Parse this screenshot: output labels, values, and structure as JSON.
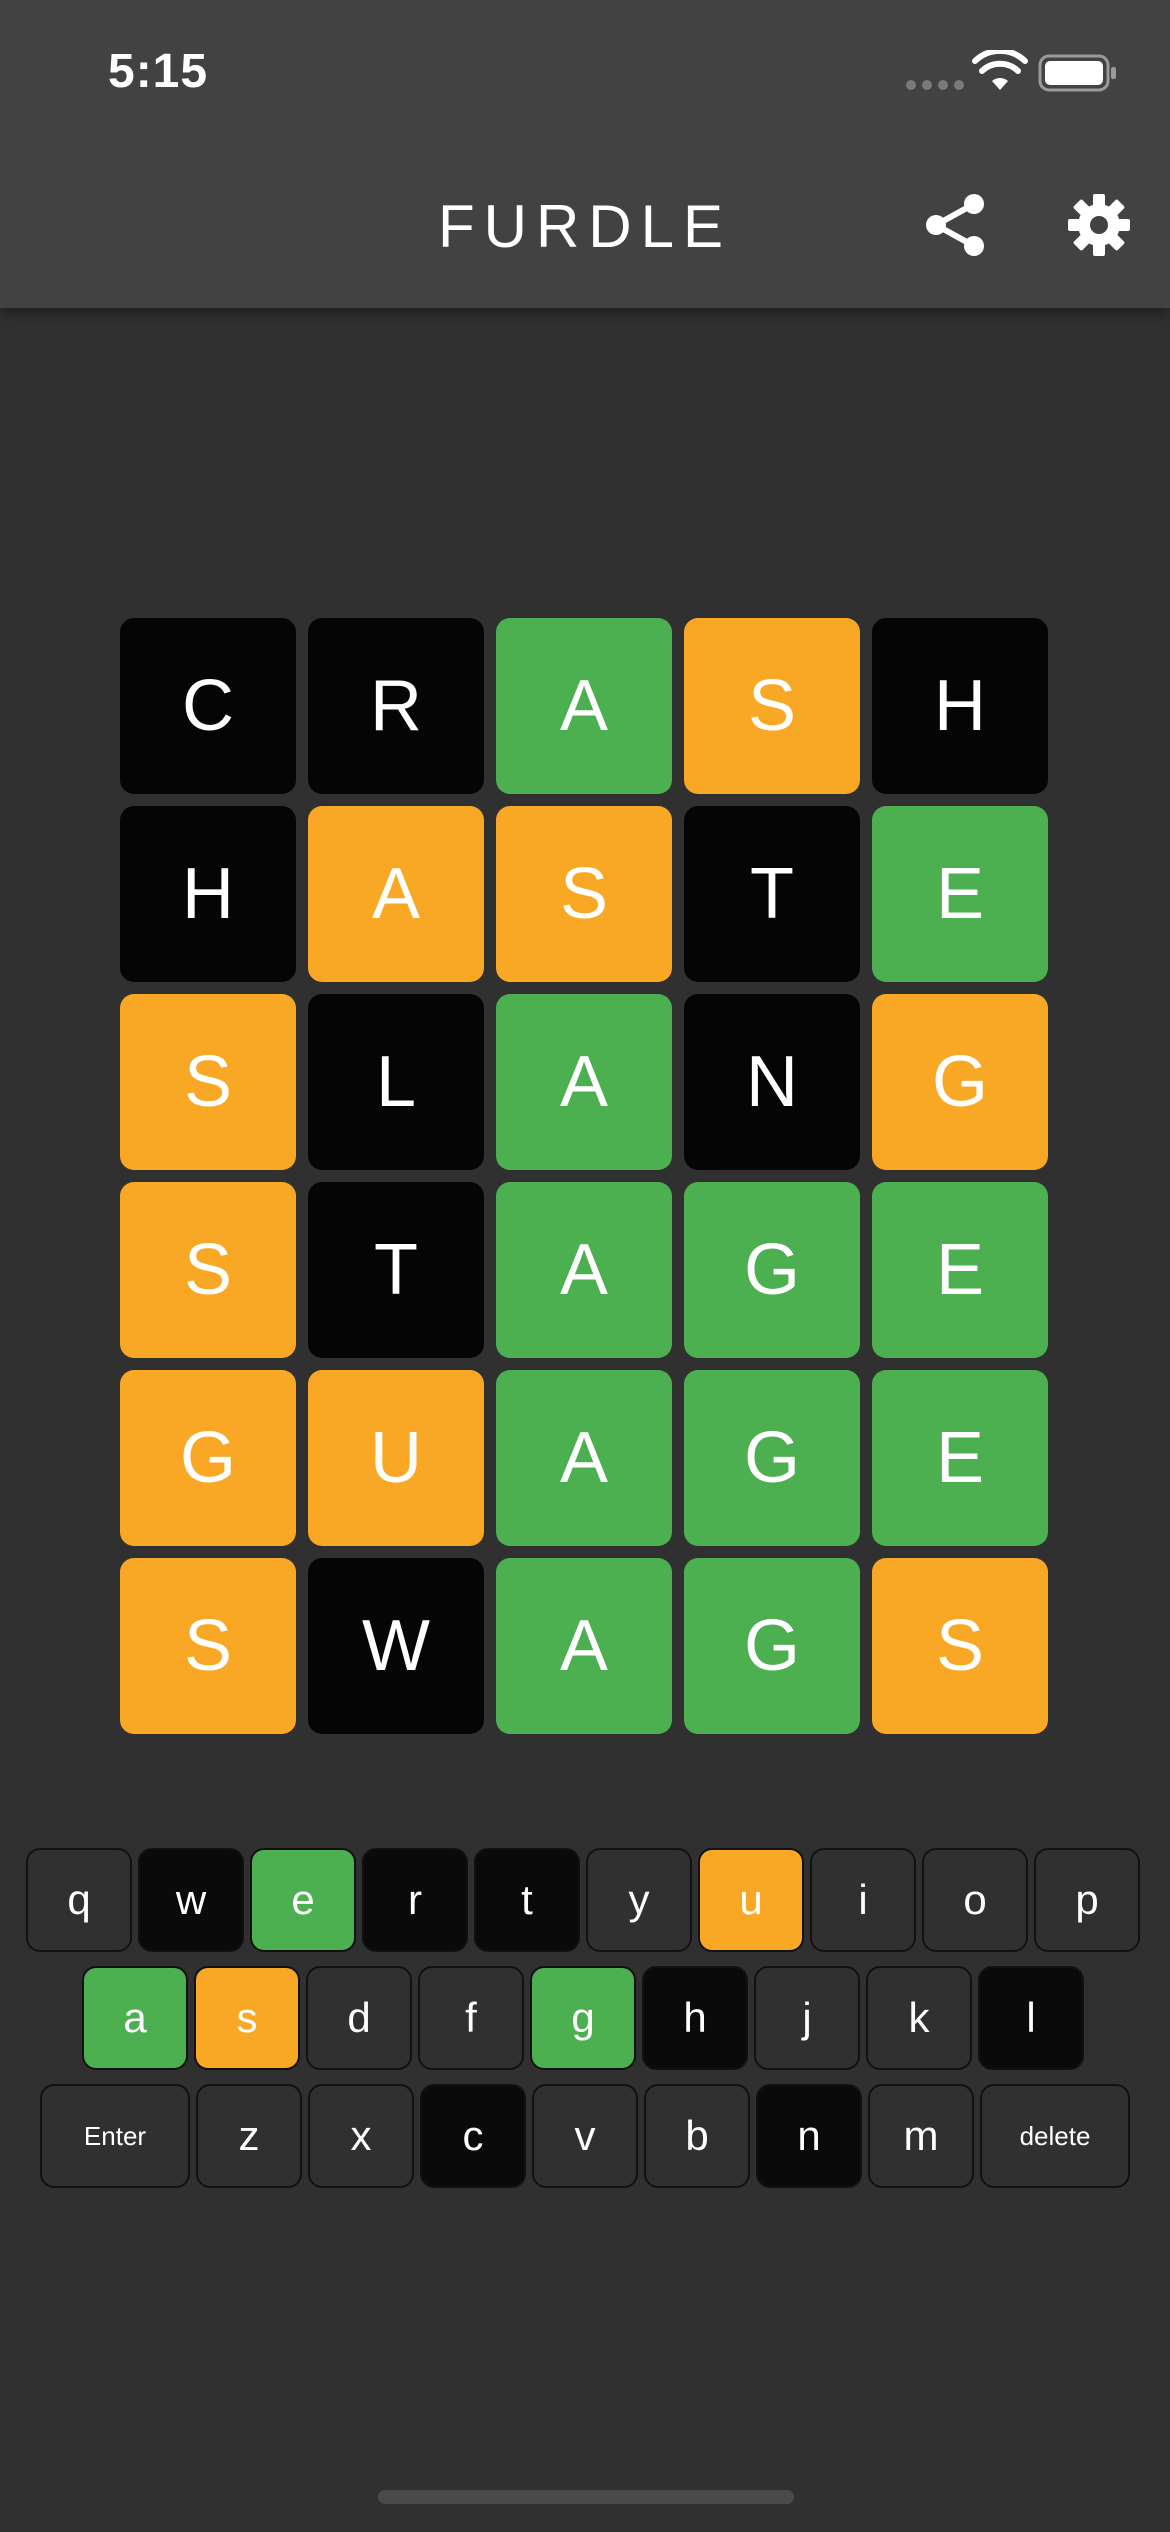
{
  "status_bar": {
    "time": "5:15"
  },
  "app_bar": {
    "title": "FURDLE",
    "share_icon": "share-icon",
    "settings_icon": "gear-icon"
  },
  "colors": {
    "background": "#303030",
    "app_bar": "#424242",
    "absent": "#050505",
    "present": "#f9a825",
    "correct": "#4caf50",
    "unused_key": "#303030"
  },
  "board": {
    "rows": [
      [
        {
          "l": "C",
          "s": "absent"
        },
        {
          "l": "R",
          "s": "absent"
        },
        {
          "l": "A",
          "s": "correct"
        },
        {
          "l": "S",
          "s": "present"
        },
        {
          "l": "H",
          "s": "absent"
        }
      ],
      [
        {
          "l": "H",
          "s": "absent"
        },
        {
          "l": "A",
          "s": "present"
        },
        {
          "l": "S",
          "s": "present"
        },
        {
          "l": "T",
          "s": "absent"
        },
        {
          "l": "E",
          "s": "correct"
        }
      ],
      [
        {
          "l": "S",
          "s": "present"
        },
        {
          "l": "L",
          "s": "absent"
        },
        {
          "l": "A",
          "s": "correct"
        },
        {
          "l": "N",
          "s": "absent"
        },
        {
          "l": "G",
          "s": "present"
        }
      ],
      [
        {
          "l": "S",
          "s": "present"
        },
        {
          "l": "T",
          "s": "absent"
        },
        {
          "l": "A",
          "s": "correct"
        },
        {
          "l": "G",
          "s": "correct"
        },
        {
          "l": "E",
          "s": "correct"
        }
      ],
      [
        {
          "l": "G",
          "s": "present"
        },
        {
          "l": "U",
          "s": "present"
        },
        {
          "l": "A",
          "s": "correct"
        },
        {
          "l": "G",
          "s": "correct"
        },
        {
          "l": "E",
          "s": "correct"
        }
      ],
      [
        {
          "l": "S",
          "s": "present"
        },
        {
          "l": "W",
          "s": "absent"
        },
        {
          "l": "A",
          "s": "correct"
        },
        {
          "l": "G",
          "s": "correct"
        },
        {
          "l": "S",
          "s": "present"
        }
      ]
    ]
  },
  "keyboard": {
    "rows": [
      [
        {
          "k": "q",
          "s": "unused"
        },
        {
          "k": "w",
          "s": "absent"
        },
        {
          "k": "e",
          "s": "correct"
        },
        {
          "k": "r",
          "s": "absent"
        },
        {
          "k": "t",
          "s": "absent"
        },
        {
          "k": "y",
          "s": "unused"
        },
        {
          "k": "u",
          "s": "present"
        },
        {
          "k": "i",
          "s": "unused"
        },
        {
          "k": "o",
          "s": "unused"
        },
        {
          "k": "p",
          "s": "unused"
        }
      ],
      [
        {
          "k": "a",
          "s": "correct"
        },
        {
          "k": "s",
          "s": "present"
        },
        {
          "k": "d",
          "s": "unused"
        },
        {
          "k": "f",
          "s": "unused"
        },
        {
          "k": "g",
          "s": "correct"
        },
        {
          "k": "h",
          "s": "absent"
        },
        {
          "k": "j",
          "s": "unused"
        },
        {
          "k": "k",
          "s": "unused"
        },
        {
          "k": "l",
          "s": "absent"
        }
      ],
      [
        {
          "k": "Enter",
          "s": "unused"
        },
        {
          "k": "z",
          "s": "unused"
        },
        {
          "k": "x",
          "s": "unused"
        },
        {
          "k": "c",
          "s": "absent"
        },
        {
          "k": "v",
          "s": "unused"
        },
        {
          "k": "b",
          "s": "unused"
        },
        {
          "k": "n",
          "s": "absent"
        },
        {
          "k": "m",
          "s": "unused"
        },
        {
          "k": "delete",
          "s": "unused"
        }
      ]
    ]
  }
}
